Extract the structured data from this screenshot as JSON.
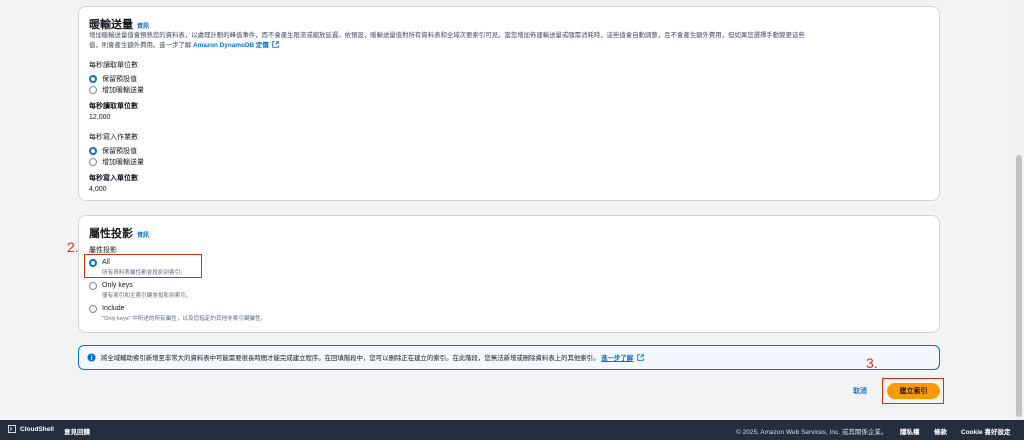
{
  "throughput": {
    "title": "暖輸送量",
    "info": "資訊",
    "desc_line1": "增加暖輸送量值會預熱您的資料表，以處理計劃的峰值事件，而不會產生限流或縮放延遲。依預設，暖輸送量值對所有資料表和全域次要索引可見。當您增加佈建輸送量或隨需消耗時，這些值會自動調整，且不會產生額外費用，但如果您選擇手動變更這些",
    "desc_line2_prefix": "值，則會產生額外費用。進一步了解",
    "desc_link": "Amazon DynamoDB 定價",
    "read_units_label": "每秒讀取單位數",
    "read_options": [
      "保留預設值",
      "增加暖輸送量"
    ],
    "read_value_label": "每秒讀取單位數",
    "read_value": "12,000",
    "write_label": "每秒寫入作業數",
    "write_options": [
      "保留預設值",
      "增加暖輸送量"
    ],
    "write_value_label": "每秒寫入單位數",
    "write_value": "4,000"
  },
  "projection": {
    "title": "屬性投影",
    "info": "資訊",
    "label": "屬性投影",
    "options": [
      {
        "label": "All",
        "sub": "所有資料表屬性都會投影到索引。"
      },
      {
        "label": "Only keys",
        "sub": "僅有索引和主索引鍵會投影到索引。"
      },
      {
        "label": "Include",
        "sub": "\"Only keys\" 中所述的所有屬性，以及您指定的其他非索引鍵屬性。"
      }
    ]
  },
  "annotations": {
    "step2": "2.",
    "step3": "3."
  },
  "banner": {
    "text": "將全域輔助索引新增至非常大的資料表中可能需要很長時間才能完成建立程序。在回填階段中，您可以刪除正在建立的索引。在此階段，您無法新增或刪除資料表上的其他索引。",
    "link": "進一步了解"
  },
  "actions": {
    "cancel": "取消",
    "create": "建立索引"
  },
  "footer": {
    "cloudshell": "CloudShell",
    "feedback": "意見回饋",
    "copyright": "© 2025, Amazon Web Services, Inc. 或其關係企業。",
    "privacy": "隱私權",
    "terms": "條款",
    "cookie": "Cookie 喜好設定"
  },
  "colors": {
    "accent": "#0972d3",
    "primary_button": "#ff9900",
    "annotation": "#d13212",
    "footer_bg": "#232f3e"
  }
}
